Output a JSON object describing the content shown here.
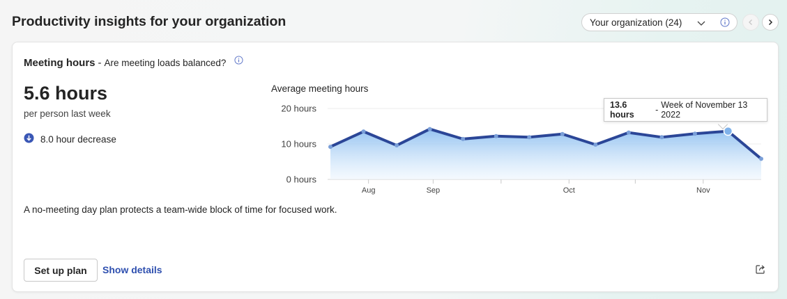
{
  "page": {
    "title": "Productivity insights for your organization"
  },
  "org_selector": {
    "value": "Your organization (24)"
  },
  "card": {
    "title": "Meeting hours",
    "separator": "-",
    "subtitle": "Are meeting loads balanced?",
    "metric_value": "5.6 hours",
    "metric_caption": "per person last week",
    "trend_text": "8.0 hour decrease",
    "description": "A no-meeting day plan protects a team-wide block of time for focused work.",
    "setup_button": "Set up plan",
    "details_link": "Show details"
  },
  "tooltip": {
    "value": "13.6 hours",
    "separator": "-",
    "label": "Week of November 13 2022"
  },
  "colors": {
    "accent_line": "#2b4697",
    "area_top": "#8fc0f0",
    "area_bottom": "#eef6fe",
    "link": "#2e4faf",
    "trend_icon": "#3a57b5"
  },
  "chart_data": {
    "type": "area",
    "title": "Average meeting hours",
    "y_ticks": [
      "20 hours",
      "10 hours",
      "0 hours"
    ],
    "ylim": [
      0,
      20
    ],
    "x_tick_labels": [
      "Aug",
      "Sep",
      "Oct",
      "Nov"
    ],
    "series": [
      {
        "values": [
          9.2,
          13.5,
          9.6,
          14.2,
          11.4,
          12.2,
          11.9,
          12.8,
          9.8,
          13.2,
          11.9,
          12.9,
          13.6,
          5.8
        ]
      }
    ],
    "highlighted_point_index": 12,
    "grid": true
  }
}
